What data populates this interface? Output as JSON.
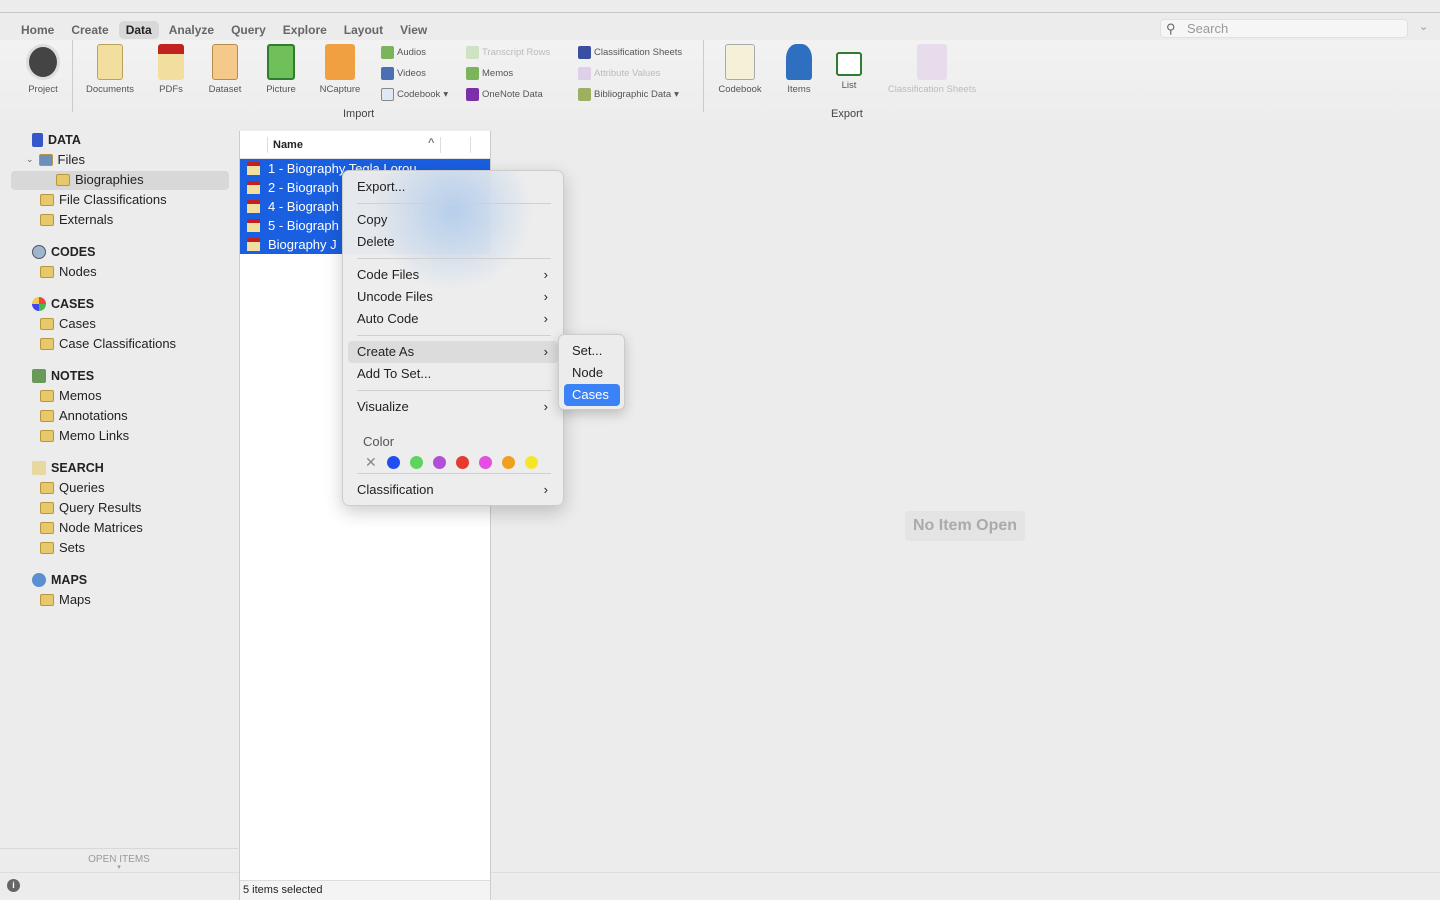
{
  "tabs": [
    "Home",
    "Create",
    "Data",
    "Analyze",
    "Query",
    "Explore",
    "Layout",
    "View"
  ],
  "active_tab": "Data",
  "search": {
    "placeholder": "Search"
  },
  "ribbon": {
    "project": "Project",
    "import_big": [
      "Documents",
      "PDFs",
      "Dataset",
      "Picture",
      "NCapture"
    ],
    "import_small_col1": [
      "Audios",
      "Videos",
      "Codebook"
    ],
    "import_small_col2": [
      "Transcript Rows",
      "Memos",
      "OneNote Data"
    ],
    "import_small_col3": [
      "Classification Sheets",
      "Attribute Values",
      "Bibliographic Data"
    ],
    "import_label": "Import",
    "export_big": [
      "Codebook",
      "Items",
      "List",
      "Classification Sheets"
    ],
    "export_label": "Export"
  },
  "sidebar": {
    "sections": [
      {
        "title": "DATA",
        "items": [
          "Files",
          "Biographies",
          "File Classifications",
          "Externals"
        ]
      },
      {
        "title": "CODES",
        "items": [
          "Nodes"
        ]
      },
      {
        "title": "CASES",
        "items": [
          "Cases",
          "Case Classifications"
        ]
      },
      {
        "title": "NOTES",
        "items": [
          "Memos",
          "Annotations",
          "Memo Links"
        ]
      },
      {
        "title": "SEARCH",
        "items": [
          "Queries",
          "Query Results",
          "Node Matrices",
          "Sets"
        ]
      },
      {
        "title": "MAPS",
        "items": [
          "Maps"
        ]
      }
    ],
    "open_items": "OPEN ITEMS"
  },
  "list": {
    "header": "Name",
    "rows": [
      "1 - Biography Tegla Lorou",
      "2 - Biograph",
      "4 - Biograph",
      "5 - Biograph",
      "Biography J"
    ],
    "status": "5 items selected"
  },
  "main": {
    "empty": "No Item Open"
  },
  "context_menu": {
    "items": [
      "Export...",
      "Copy",
      "Delete",
      "Code Files",
      "Uncode Files",
      "Auto Code",
      "Create As",
      "Add To Set...",
      "Visualize",
      "Classification"
    ],
    "color_label": "Color",
    "colors": [
      "#1f4ff0",
      "#5fd35f",
      "#b14fd6",
      "#e53a2e",
      "#e44fe0",
      "#f0a020",
      "#f5e62a"
    ],
    "submenu": [
      "Set...",
      "Node",
      "Cases"
    ],
    "submenu_selected": "Cases"
  }
}
